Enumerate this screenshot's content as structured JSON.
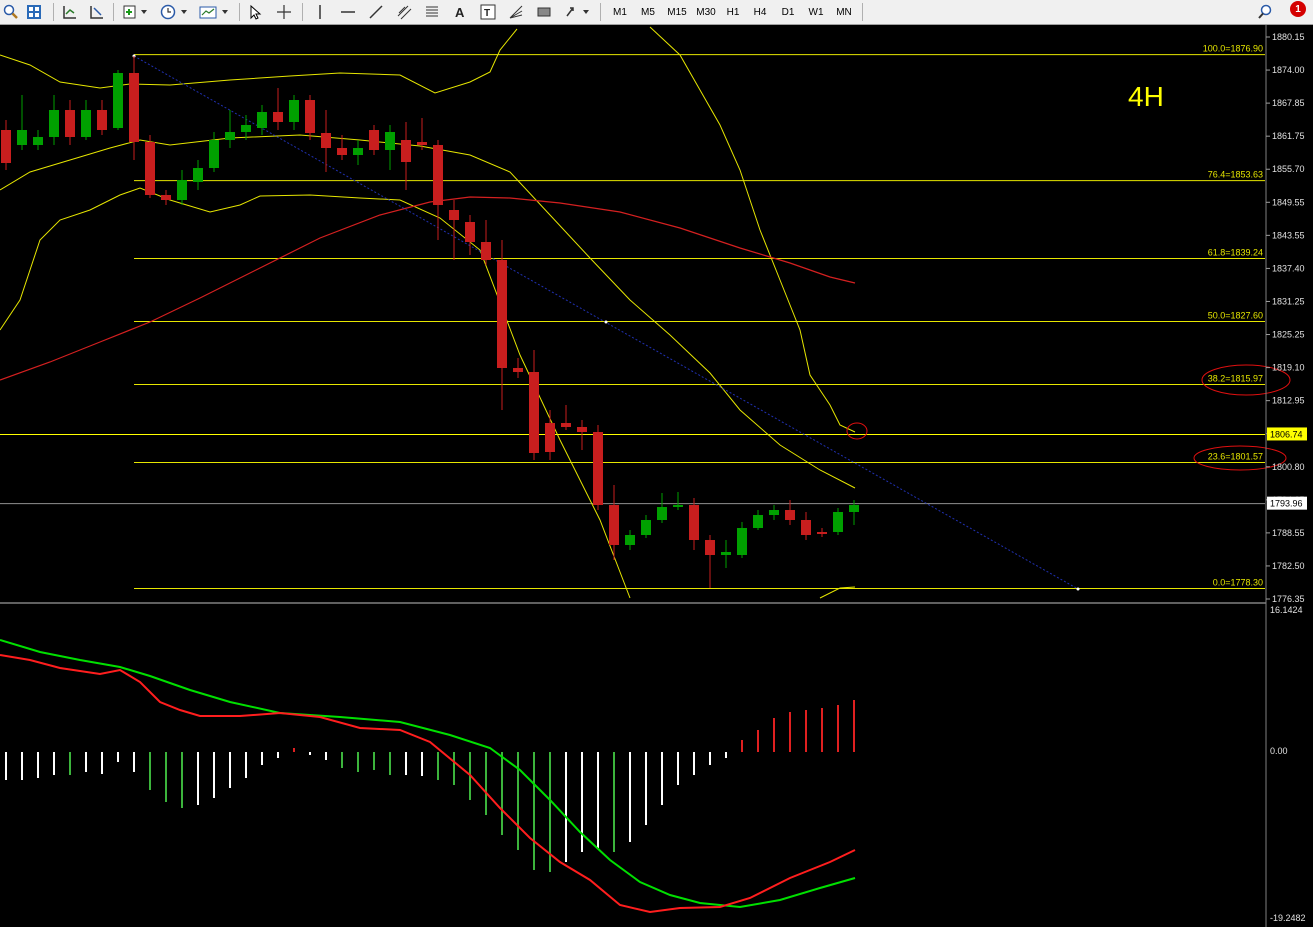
{
  "toolbar": {
    "timeframes": [
      "M1",
      "M5",
      "M15",
      "M30",
      "H1",
      "H4",
      "D1",
      "W1",
      "MN"
    ],
    "alert_count": "1"
  },
  "chart": {
    "timeframe_label": "4H",
    "price_axis": [
      "1880.15",
      "1874.00",
      "1867.85",
      "1861.75",
      "1855.70",
      "1849.55",
      "1843.55",
      "1837.40",
      "1831.25",
      "1825.25",
      "1819.10",
      "1812.95",
      "1806.90",
      "1800.80",
      "1794.65",
      "1788.55",
      "1782.50",
      "1776.35"
    ],
    "fib_levels": [
      {
        "label": "100.0=1876.90",
        "price": 1876.9
      },
      {
        "label": "76.4=1853.63",
        "price": 1853.63
      },
      {
        "label": "61.8=1839.24",
        "price": 1839.24
      },
      {
        "label": "50.0=1827.60",
        "price": 1827.6
      },
      {
        "label": "38.2=1815.97",
        "price": 1815.97
      },
      {
        "label": "23.6=1801.57",
        "price": 1801.57
      },
      {
        "label": "0.0=1778.30",
        "price": 1778.3
      }
    ],
    "horizontal_level": {
      "label": "1806.74",
      "price": 1806.74
    },
    "current_price": {
      "label": "1793.96",
      "price": 1793.96
    },
    "indicator_axis": {
      "top": "16.1424",
      "zero": "0.00",
      "bottom": "-19.2482"
    },
    "colors": {
      "bull": "#00a000",
      "bear": "#c81e1e",
      "fib": "#e6e600",
      "bollinger": "#e6e600",
      "ma": "#d42020",
      "trendline": "#2030b0",
      "hline_badge": "#ffff00",
      "osc_green": "#00e000",
      "osc_red": "#ff1e1e"
    }
  }
}
